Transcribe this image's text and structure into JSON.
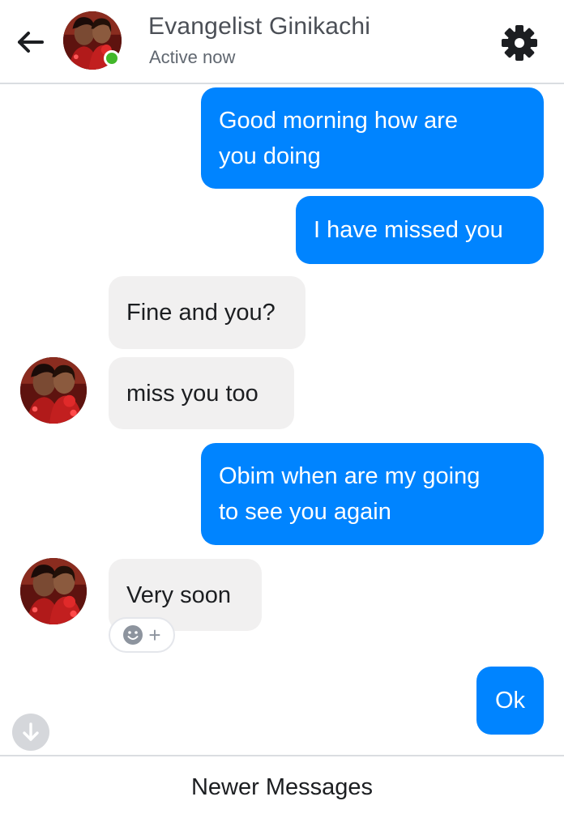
{
  "header": {
    "contact_name": "Evangelist Ginikachi",
    "status": "Active now",
    "back_icon": "arrow-left-icon",
    "settings_icon": "gear-icon",
    "online_color": "#42b72a"
  },
  "messages": [
    {
      "direction": "outgoing",
      "text": "Good morning how are\nyou doing"
    },
    {
      "direction": "outgoing",
      "text": "I have missed you"
    },
    {
      "direction": "incoming",
      "text": "Fine and you?"
    },
    {
      "direction": "incoming",
      "text": "miss you too"
    },
    {
      "direction": "outgoing",
      "text": "Obim when are my going\nto see you again"
    },
    {
      "direction": "incoming",
      "text": "Very soon"
    },
    {
      "direction": "outgoing",
      "text": "Ok"
    }
  ],
  "reaction_button": {
    "icon": "smiley-icon",
    "label": "+"
  },
  "scroll_down_icon": "arrow-down-icon",
  "footer": {
    "newer_messages": "Newer Messages"
  },
  "colors": {
    "outgoing_bubble": "#0084ff",
    "incoming_bubble": "#f1f0f0"
  }
}
